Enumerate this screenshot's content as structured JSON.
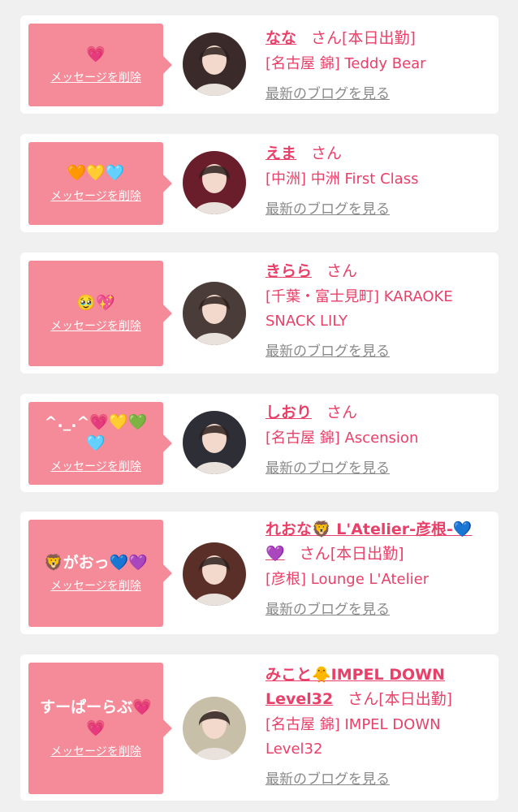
{
  "delete_label": "メッセージを削除",
  "blog_label": "最新のブログを見る",
  "san_label": "さん",
  "colors": {
    "bubble": "#f58a98",
    "accent": "#e94069",
    "link_gray": "#8a8a8a",
    "background": "#f0f0f0"
  },
  "entries": [
    {
      "message": "💗",
      "name": "なな",
      "working": "[本日出勤]",
      "shop": "[名古屋 錦] Teddy Bear",
      "avatar_tone": "#3b2a2a"
    },
    {
      "message": "🧡💛🩵",
      "name": "えま",
      "working": "",
      "shop": "[中洲] 中洲 First Class",
      "avatar_tone": "#6a1e2c"
    },
    {
      "message": "🥹💖",
      "name": "きらら",
      "working": "",
      "shop": "[千葉・富士見町] KARAOKE SNACK LILY",
      "avatar_tone": "#4a3c38"
    },
    {
      "message": "^._.^💗💛💚🩵",
      "name": "しおり",
      "working": "",
      "shop": "[名古屋 錦] Ascension",
      "avatar_tone": "#2e2e36"
    },
    {
      "message": "🦁がおっ💙💜",
      "name": "れおな🦁 L'Atelier-彦根-💙💜",
      "working": "[本日出勤]",
      "shop": "[彦根] Lounge L'Atelier",
      "avatar_tone": "#5a2f28"
    },
    {
      "message": "すーぱーらぶ💗💗",
      "name": "みこと🐥IMPEL DOWN Level32",
      "working": "[本日出勤]",
      "shop": "[名古屋 錦] IMPEL DOWN Level32",
      "avatar_tone": "#c7bfa8"
    }
  ]
}
